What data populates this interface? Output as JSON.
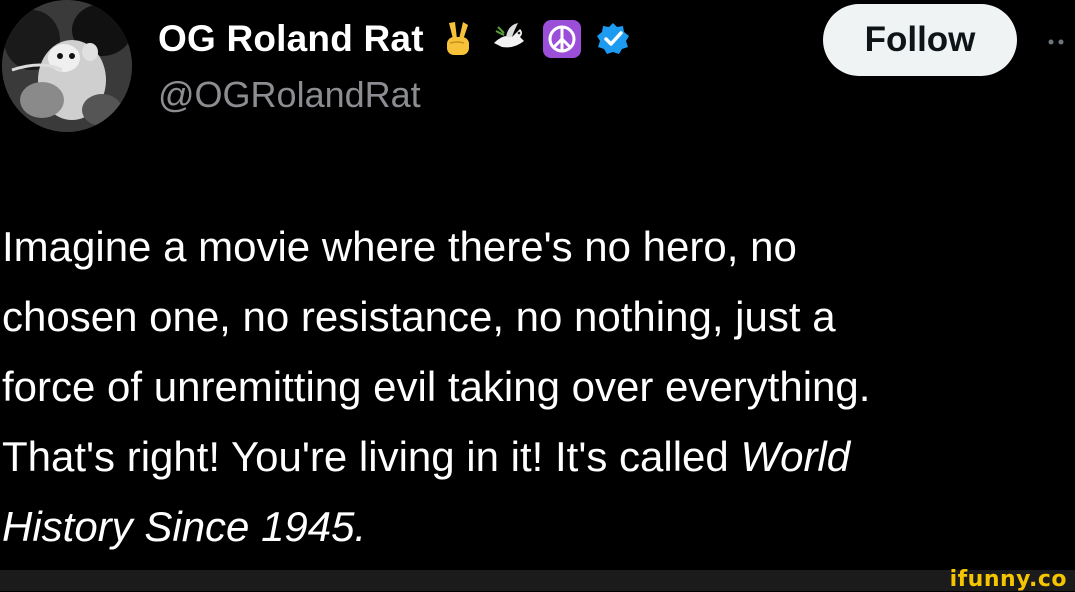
{
  "author": {
    "display_name": "OG Roland Rat",
    "handle": "@OGRolandRat",
    "name_emojis": [
      "victory-hand",
      "dove",
      "peace-symbol"
    ],
    "verified": true,
    "verified_color": "#1d9bf0"
  },
  "follow_button": {
    "label": "Follow"
  },
  "tweet": {
    "line1": "Imagine a movie where there's no hero, no",
    "line2": "chosen one, no resistance, no nothing, just a",
    "line3": "force of unremitting evil taking over everything.",
    "line4_plain": "That's right! You're living in it! It's called ",
    "line4_italic": "World",
    "line5_italic": "History Since 1945."
  },
  "watermark": {
    "text": "ifunny.co",
    "color": "#f4c500"
  },
  "colors": {
    "background": "#000000",
    "text_primary": "#ffffff",
    "text_secondary": "#8b8d91",
    "button_bg": "#eff3f4"
  }
}
